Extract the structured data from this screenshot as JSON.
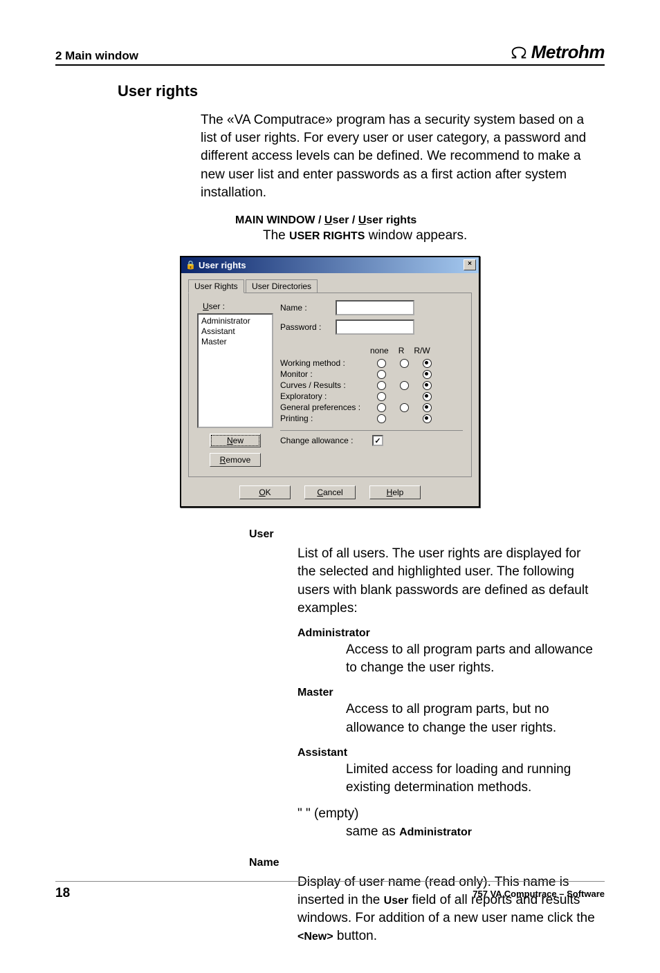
{
  "header": {
    "chapter": "2  Main window",
    "brand": "Metrohm"
  },
  "section": {
    "title": "User rights"
  },
  "intro": "The «VA Computrace» program has a security system based on a list of user rights. For every user or user category, a password and different access levels can be defined. We recommend to make a new user list and enter passwords as a first action after system installation.",
  "menupath": {
    "root": "MAIN WINDOW",
    "sep": " / ",
    "m1_pre": "U",
    "m1_rest": "ser",
    "m2_pre": "U",
    "m2_rest": "ser rights"
  },
  "caption": {
    "pre": "The ",
    "bold": "USER RIGHTS",
    "post": " window appears."
  },
  "dialog": {
    "title": "User rights",
    "tabs": {
      "active": "User Rights",
      "other": "User Directories"
    },
    "user_label_pre": "U",
    "user_label_rest": "ser :",
    "users": [
      "Administrator",
      "Assistant",
      "Master"
    ],
    "new_pre": "N",
    "new_rest": "ew",
    "remove_pre": "R",
    "remove_rest": "emove",
    "name_label": "Name :",
    "pass_label": "Password :",
    "headers": {
      "none": "none",
      "r": "R",
      "rw": "R/W"
    },
    "perms": [
      {
        "label": "Working method :",
        "cells": [
          "o",
          "o",
          "sel"
        ]
      },
      {
        "label": "Monitor :",
        "cells": [
          "o",
          "blank",
          "sel"
        ]
      },
      {
        "label": "Curves / Results :",
        "cells": [
          "o",
          "o",
          "sel"
        ]
      },
      {
        "label": "Exploratory :",
        "cells": [
          "o",
          "blank",
          "sel"
        ]
      },
      {
        "label": "General preferences :",
        "cells": [
          "o",
          "o",
          "sel"
        ]
      },
      {
        "label": "Printing :",
        "cells": [
          "o",
          "blank",
          "sel"
        ]
      }
    ],
    "change_label": "Change allowance :",
    "change_checked": "✓",
    "ok_pre": "O",
    "ok_rest": "K",
    "cancel_pre": "C",
    "cancel_rest": "ancel",
    "help_pre": "H",
    "help_rest": "elp"
  },
  "defs": {
    "user_term": "User",
    "user_body": "List of all users. The user rights are displayed for the selected and highlighted user. The following users with blank passwords are defined as default examples:",
    "admin_term": "Administrator",
    "admin_body": "Access to all program parts and allowance to change the user rights.",
    "master_term": "Master",
    "master_body": "Access to all program parts, but no allowance to change the user rights.",
    "assistant_term": "Assistant",
    "assistant_body": "Limited access for loading and running existing determination methods.",
    "empty_term": "\"  \" (empty)",
    "empty_body_pre": "same as ",
    "empty_body_bold": "Administrator",
    "name_term": "Name",
    "name_body_1": "Display of user name (read only). This name is inserted in the ",
    "name_body_bold1": "User",
    "name_body_2": " field of all reports and results windows. For addition of a new user name click the ",
    "name_body_bold2": "<New>",
    "name_body_3": " button."
  },
  "footer": {
    "page": "18",
    "text": "757 VA Computrace – Software"
  }
}
